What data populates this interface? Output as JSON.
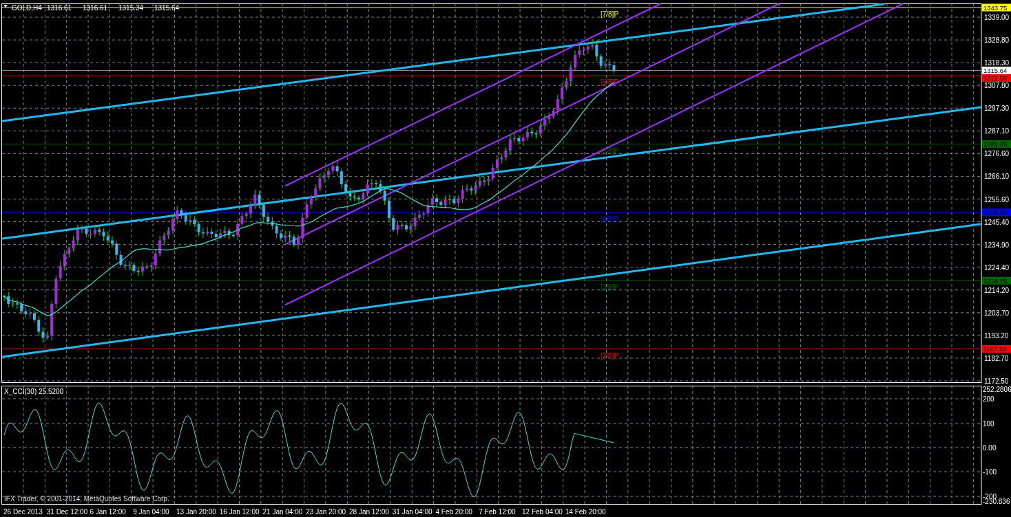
{
  "chart": {
    "symbol": "GOLD,H4",
    "ohlc": [
      "1316.61",
      "1316.61",
      "1315.34",
      "1315.64"
    ],
    "bid": "1315.64"
  },
  "price_axis": {
    "ticks": [
      "1339.00",
      "1328.80",
      "1318.30",
      "1307.80",
      "1297.30",
      "1287.10",
      "1276.60",
      "1266.10",
      "1255.60",
      "1245.40",
      "1234.90",
      "1224.40",
      "1214.20",
      "1203.70",
      "1193.20",
      "1182.70",
      "1172.50"
    ]
  },
  "murrey_levels": [
    {
      "label": "[7/8]P",
      "price": "1343.75",
      "color": "#ffff00"
    },
    {
      "label": "[6/8]P",
      "price": "1312.50",
      "color": "#ff0000"
    },
    {
      "label": "[5/8]P",
      "price": "1281.25",
      "color": "#006400"
    },
    {
      "label": "[4/8]P",
      "price": "1250.00",
      "color": "#0000ff"
    },
    {
      "label": "[3/8]P",
      "price": "1218.75",
      "color": "#006400"
    },
    {
      "label": "[2/8]P",
      "price": "1187.50",
      "color": "#ff0000"
    }
  ],
  "indicator": {
    "caption": "X_CCI(30) 25.5200",
    "axis_ticks": [
      "252.2806",
      "200",
      "100",
      "0.00",
      "-100",
      "-200",
      "-230.836"
    ]
  },
  "time_axis": {
    "labels": [
      "26 Dec 2013",
      "31 Dec 12:00",
      "6 Jan 12:00",
      "9 Jan 04:00",
      "13 Jan 20:00",
      "16 Jan 12:00",
      "21 Jan 04:00",
      "23 Jan 20:00",
      "28 Jan 12:00",
      "31 Jan 04:00",
      "4 Feb 20:00",
      "7 Feb 12:00",
      "12 Feb 04:00",
      "14 Feb 20:00"
    ]
  },
  "copyright": "IFX Trader, © 2001-2014, MetaQuotes Software Corp."
}
